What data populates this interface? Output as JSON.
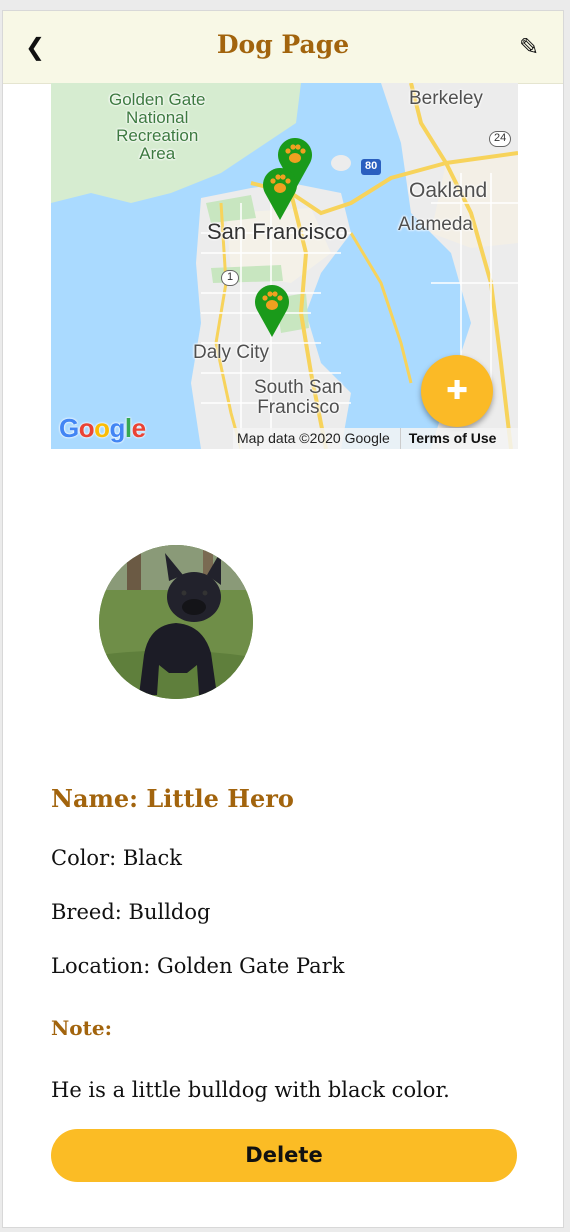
{
  "header": {
    "back_icon": "back-chevron-icon",
    "back_glyph": "❮",
    "title": "Dog Page",
    "edit_icon": "pencil-icon",
    "edit_glyph": "✎"
  },
  "map": {
    "labels": {
      "ggnra": "Golden Gate\nNational\nRecreation\nArea",
      "berkeley": "Berkeley",
      "oakland": "Oakland",
      "alameda": "Alameda",
      "san_francisco": "San Francisco",
      "daly_city": "Daly City",
      "south_sf": "South San\nFrancisco",
      "hwy_80": "80",
      "hwy_24": "24",
      "hwy_1": "1"
    },
    "marker_icon": "paw-marker-icon",
    "add_button_glyph": "✚",
    "google_logo": [
      "G",
      "o",
      "o",
      "g",
      "l",
      "e"
    ],
    "google_colors": [
      "#4285F4",
      "#EA4335",
      "#FBBC05",
      "#4285F4",
      "#34A853",
      "#EA4335"
    ],
    "attribution": "Map data ©2020 Google",
    "terms": "Terms of Use"
  },
  "dog": {
    "avatar_alt": "black-bulldog-photo",
    "name_line": "Name: Little Hero",
    "color_line": "Color: Black",
    "breed_line": "Breed: Bulldog",
    "location_line": "Location: Golden Gate Park",
    "note_label": "Note:",
    "note_text": "He is a little bulldog with black color."
  },
  "actions": {
    "delete_label": "Delete"
  },
  "colors": {
    "accent": "#a2640d",
    "button": "#fbbc25",
    "header_bg": "#f8f8e6",
    "marker": "#1a9a1a"
  }
}
